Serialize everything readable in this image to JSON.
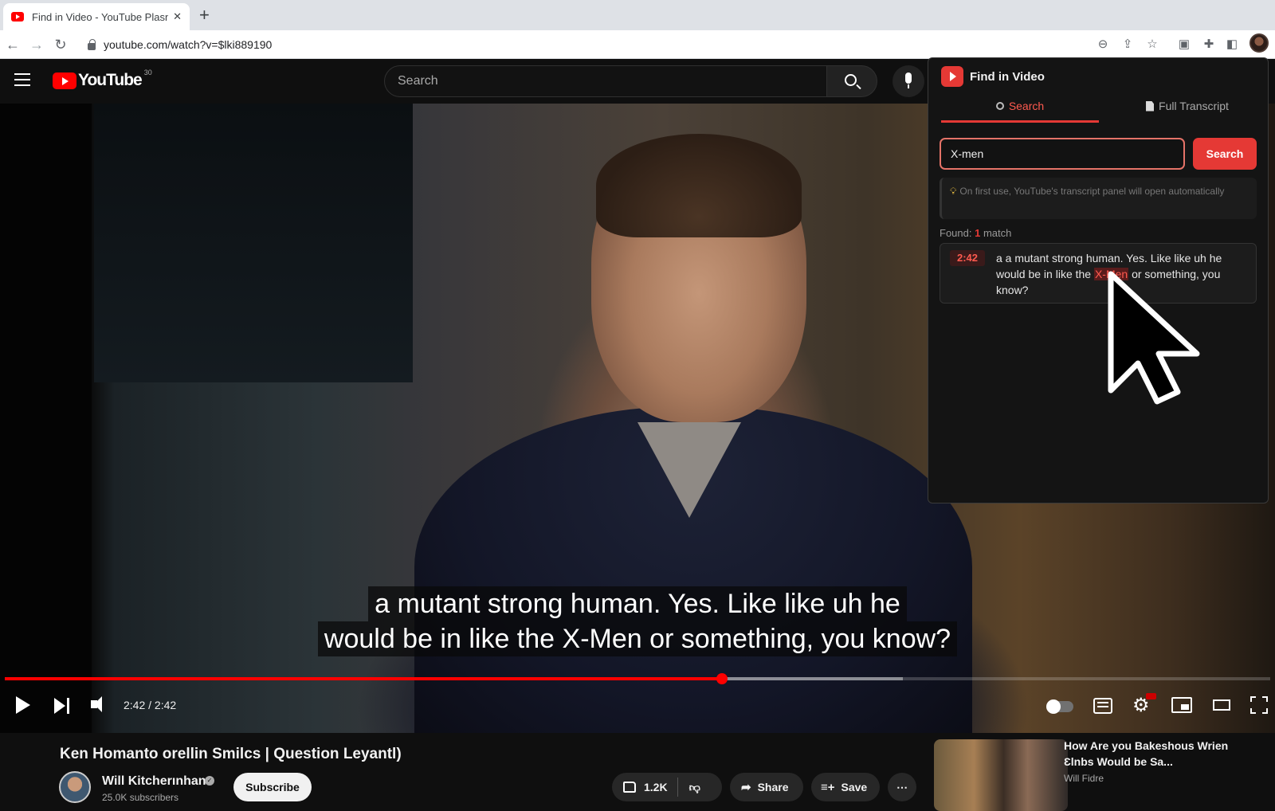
{
  "browser": {
    "tab_title": "Find in Video - YouTube Plasn",
    "tab_close": "✕",
    "new_tab": "+",
    "url": "youtube.com/watch?v=$lki889190"
  },
  "youtube": {
    "logo_text": "YouTube",
    "logo_sup": "30",
    "search_placeholder": "Search"
  },
  "video": {
    "subtitle_line1": "a mutant strong human. Yes. Like like uh he",
    "subtitle_line2": "would be in like the X-Men or something, you know?",
    "time_display": "2:42 / 2:42",
    "played_fraction": 0.567,
    "buffered_fraction": 0.71
  },
  "below": {
    "title": "Ken Homanto orellin Smilcs | Question Leyantl)",
    "channel_name": "Will Kitcherınhan",
    "subscribers": "25.0K subscribers",
    "subscribe_label": "Subscribe",
    "likes": "1.2K",
    "share_label": "Share",
    "save_label": "Save",
    "more_label": "⋯",
    "rec_title": "How Are you Bakeshous Wrien Ɛlnbs Would be Sa...",
    "rec_channel": "Will Fidre"
  },
  "extension": {
    "title": "Find in Video",
    "tab_search": "Search",
    "tab_full": "Full Transcript",
    "query": "X-men",
    "search_button": "Search",
    "tip": "On first use, YouTube's transcript panel will open automatically",
    "found_prefix": "Found: ",
    "found_count": "1",
    "found_suffix": " match",
    "result_time": "2:42",
    "result_before": "a a mutant strong human. Yes. Like like uh he would be in like the ",
    "result_highlight": "X-Men",
    "result_after": " or something, you know?"
  },
  "colors": {
    "accent": "#e53935",
    "progress": "#ff0000"
  }
}
